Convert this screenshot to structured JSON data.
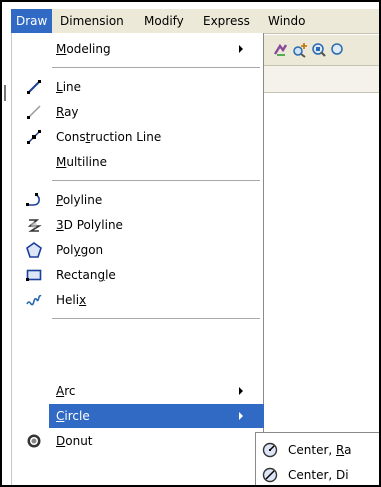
{
  "menubar": {
    "items": [
      {
        "label": "Draw",
        "active": true
      },
      {
        "label": "Dimension"
      },
      {
        "label": "Modify"
      },
      {
        "label": "Express"
      },
      {
        "label": "Windo"
      }
    ]
  },
  "draw_menu": {
    "modeling": {
      "pre": "",
      "key": "M",
      "post": "odeling"
    },
    "line": {
      "pre": "",
      "key": "L",
      "post": "ine"
    },
    "ray": {
      "pre": "",
      "key": "R",
      "post": "ay"
    },
    "construction_line": {
      "pre": "Cons",
      "key": "t",
      "post": "ruction Line"
    },
    "multiline": {
      "pre": "",
      "key": "M",
      "post": "ultiline"
    },
    "polyline": {
      "pre": "",
      "key": "P",
      "post": "olyline"
    },
    "polyline_3d": {
      "pre": "",
      "key": "3",
      "post": "D Polyline"
    },
    "polygon": {
      "pre": "Pol",
      "key": "y",
      "post": "gon"
    },
    "rectangle": {
      "pre": "Rectan",
      "key": "g",
      "post": "le"
    },
    "helix": {
      "pre": "Heli",
      "key": "x",
      "post": ""
    },
    "arc": {
      "pre": "",
      "key": "A",
      "post": "rc"
    },
    "circle": {
      "pre": "",
      "key": "C",
      "post": "ircle"
    },
    "donut": {
      "pre": "",
      "key": "D",
      "post": "onut"
    }
  },
  "circle_submenu": {
    "center_radius": {
      "pre": "Center, ",
      "key": "R",
      "post": "a"
    },
    "center_diameter": {
      "pre": "Center, Di",
      "key": "",
      "post": ""
    }
  },
  "colors": {
    "highlight": "#316ac5",
    "menubar": "#ece9d8"
  }
}
